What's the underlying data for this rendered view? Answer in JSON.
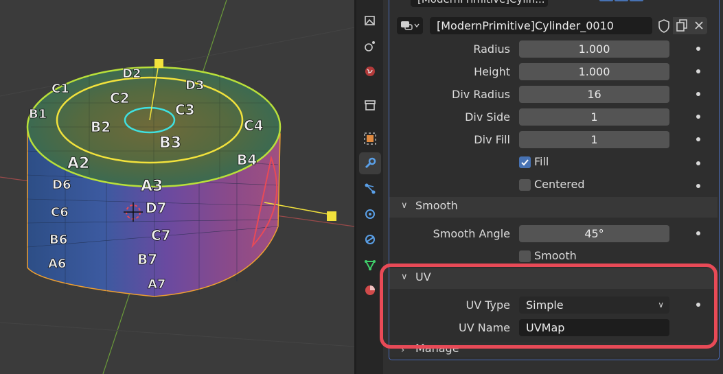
{
  "modifier": {
    "top_name_truncated": "[ModernPrimitive]Cylin...",
    "name": "[ModernPrimitive]Cylinder_0010"
  },
  "fields": [
    {
      "label": "Radius",
      "value": "1.000"
    },
    {
      "label": "Height",
      "value": "1.000"
    },
    {
      "label": "Div Radius",
      "value": "16"
    },
    {
      "label": "Div Side",
      "value": "1"
    },
    {
      "label": "Div Fill",
      "value": "1"
    }
  ],
  "checkboxes": {
    "fill": {
      "label": "Fill",
      "checked": true
    },
    "centered": {
      "label": "Centered",
      "checked": false
    }
  },
  "smooth_section": {
    "title": "Smooth",
    "angle_label": "Smooth Angle",
    "angle_value": "45°",
    "smooth_label": "Smooth"
  },
  "uv_section": {
    "title": "UV",
    "type_label": "UV Type",
    "type_value": "Simple",
    "name_label": "UV Name",
    "name_value": "UVMap"
  },
  "manage_section": {
    "title": "Manage"
  },
  "mesh_labels": [
    "D2",
    "D3",
    "C1",
    "C2",
    "C3",
    "C4",
    "B1",
    "B2",
    "B3",
    "B4",
    "A2",
    "A3",
    "D6",
    "C6",
    "B6",
    "A6",
    "D7",
    "C7",
    "B7",
    "A7"
  ],
  "colors": {
    "accent_blue": "#4772b3",
    "highlight_red": "#e84a57",
    "selection_yellow": "#f2e23c",
    "edge_orange": "#f0a030"
  },
  "icons": [
    "image-icon",
    "particles-icon",
    "world-icon",
    "collection-icon",
    "object-icon",
    "wrench-icon",
    "constraints-icon",
    "physics-icon",
    "object-data-icon",
    "material-icon"
  ]
}
